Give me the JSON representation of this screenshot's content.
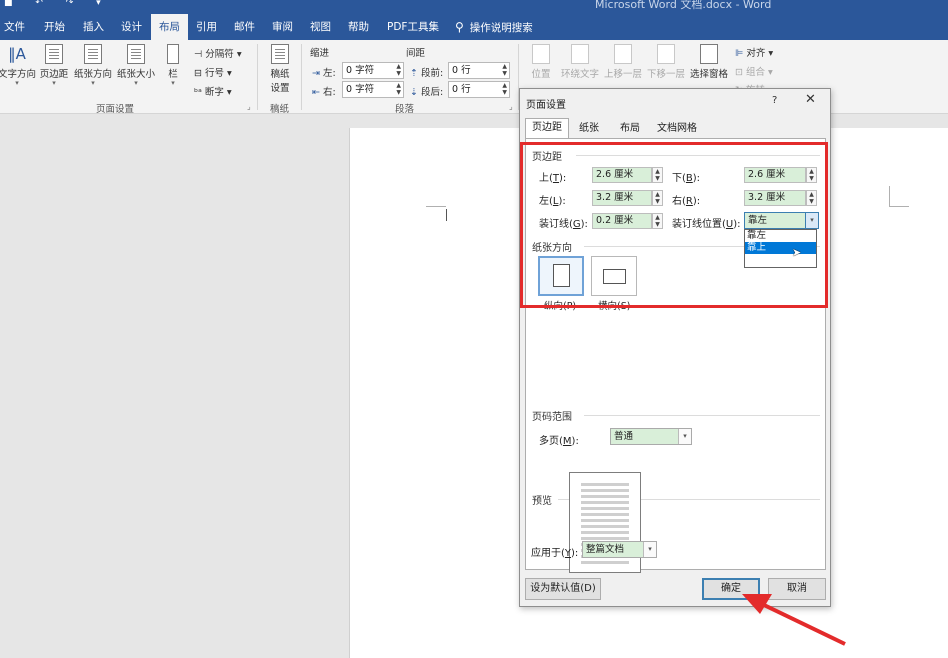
{
  "titlebar": {
    "qat_icons": [
      "save-icon",
      "undo-icon",
      "redo-icon",
      "customize-icon"
    ],
    "doc_title": "Microsoft Word 文档.docx  -  Word",
    "tabs": [
      "文件",
      "开始",
      "插入",
      "设计",
      "布局",
      "引用",
      "邮件",
      "审阅",
      "视图",
      "帮助",
      "PDF工具集"
    ],
    "active_tab": "布局",
    "tell_me": "操作说明搜索"
  },
  "ribbon": {
    "page_setup": {
      "buttons": [
        "文字方向",
        "页边距",
        "纸张方向",
        "纸张大小",
        "栏"
      ],
      "small": [
        "分隔符",
        "行号",
        "断字"
      ],
      "label": "页面设置"
    },
    "draft": {
      "button_line1": "稿纸",
      "button_line2": "设置",
      "label": "稿纸"
    },
    "paragraph": {
      "indent_title": "缩进",
      "spacing_title": "间距",
      "indent_left_label": "左:",
      "indent_left_value": "0 字符",
      "indent_right_label": "右:",
      "indent_right_value": "0 字符",
      "space_before_label": "段前:",
      "space_before_value": "0 行",
      "space_after_label": "段后:",
      "space_after_value": "0 行",
      "label": "段落"
    },
    "arrange": {
      "buttons": [
        "位置",
        "环绕文字",
        "上移一层",
        "下移一层",
        "选择窗格"
      ],
      "small": [
        "对齐",
        "组合",
        "旋转"
      ]
    }
  },
  "dialog": {
    "title": "页面设置",
    "help": "?",
    "close": "✕",
    "tabs": [
      "页边距",
      "纸张",
      "布局",
      "文档网格"
    ],
    "active_tab": "页边距",
    "margins": {
      "section": "页边距",
      "top_label": "上(",
      "top_key": "T",
      "top_value": "2.6 厘米",
      "bottom_label": "下(",
      "bottom_key": "B",
      "bottom_value": "2.6 厘米",
      "left_label": "左(",
      "left_key": "L",
      "left_value": "3.2 厘米",
      "right_label": "右(",
      "right_key": "R",
      "right_value": "3.2 厘米",
      "gutter_label": "装订线(",
      "gutter_key": "G",
      "gutter_value": "0.2 厘米",
      "gutter_pos_label": "装订线位置(",
      "gutter_pos_key": "U",
      "gutter_pos_value": "靠左",
      "gutter_pos_options": [
        "靠左",
        "靠上"
      ],
      "gutter_pos_highlighted": "靠上"
    },
    "orientation": {
      "section": "纸张方向",
      "portrait": "纵向(P)",
      "landscape": "横向(S)",
      "selected": "portrait"
    },
    "pages": {
      "section": "页码范围",
      "multi_label": "多页(",
      "multi_key": "M",
      "multi_value": "普通"
    },
    "preview": {
      "section": "预览",
      "lines": 14
    },
    "apply_to": {
      "label": "应用于(",
      "key": "Y",
      "value": "整篇文档"
    },
    "buttons": {
      "set_default": "设为默认值(D)",
      "ok": "确定",
      "cancel": "取消"
    }
  },
  "colors": {
    "word_blue": "#2b579a",
    "highlight_red": "#e32b2b",
    "field_green": "#d9efd9",
    "selection_blue": "#0078d7"
  }
}
